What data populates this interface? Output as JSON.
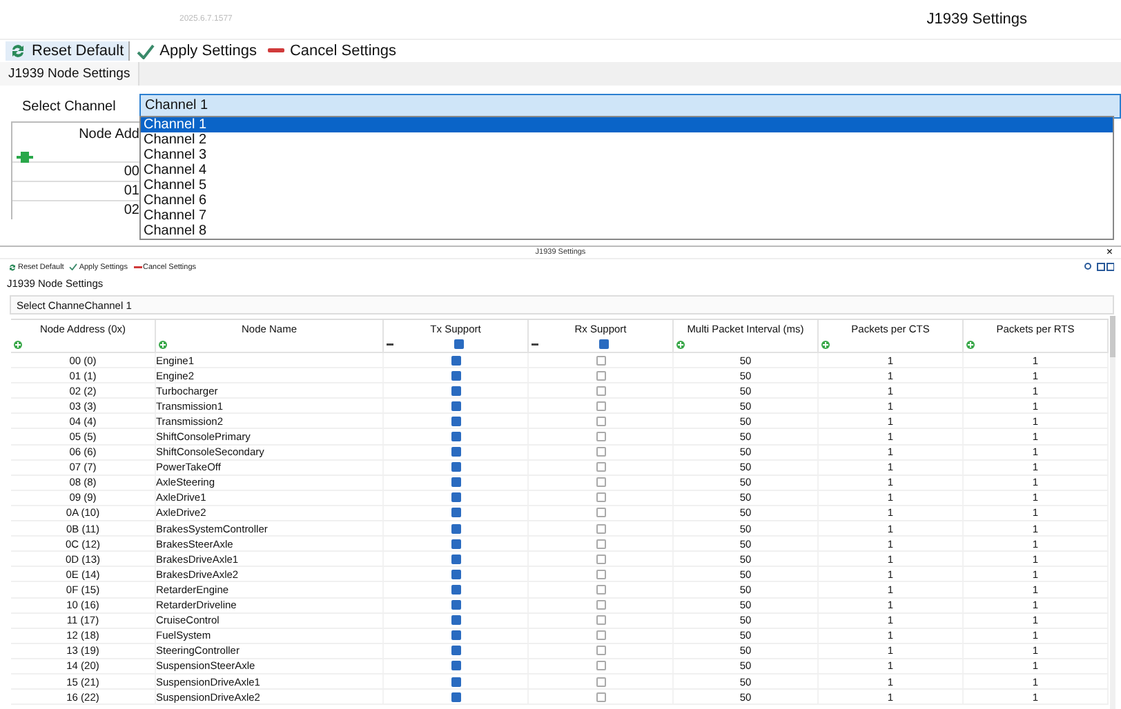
{
  "top_window": {
    "version": "2025.6.7.1577",
    "title": "J1939 Settings",
    "toolbar": [
      {
        "kind": "reset",
        "label": "Reset Default"
      },
      {
        "kind": "apply",
        "label": "Apply Settings"
      },
      {
        "kind": "cancel",
        "label": "Cancel Settings"
      }
    ],
    "tab": "J1939 Node Settings",
    "channel_label": "Select Channel",
    "channel_value": "Channel 1",
    "dropdown": [
      {
        "label": "Channel 1",
        "selected": true
      },
      {
        "label": "Channel 2",
        "selected": false
      },
      {
        "label": "Channel 3",
        "selected": false
      },
      {
        "label": "Channel 4",
        "selected": false
      },
      {
        "label": "Channel 5",
        "selected": false
      },
      {
        "label": "Channel 6",
        "selected": false
      },
      {
        "label": "Channel 7",
        "selected": false
      },
      {
        "label": "Channel 8",
        "selected": false
      }
    ],
    "table_header": "Node Add",
    "table_rows": [
      "00",
      "01",
      "02"
    ]
  },
  "bottom_window": {
    "title": "J1939 Settings",
    "close": "×",
    "toolbar": [
      {
        "kind": "reset",
        "label": "Reset Default"
      },
      {
        "kind": "apply",
        "label": "Apply Settings"
      },
      {
        "kind": "cancel",
        "label": "Cancel Settings"
      }
    ],
    "tab": "J1939 Node Settings",
    "channel_label": "Select Channe",
    "channel_value": "Channel 1",
    "columns": [
      {
        "label": "Node Address (0x)",
        "kind": "add"
      },
      {
        "label": "Node Name",
        "kind": "add"
      },
      {
        "label": "Tx Support",
        "kind": "check",
        "checked": true
      },
      {
        "label": "Rx Support",
        "kind": "check",
        "checked": true
      },
      {
        "label": "Multi Packet Interval (ms)",
        "kind": "add"
      },
      {
        "label": "Packets per CTS",
        "kind": "add"
      },
      {
        "label": "Packets per RTS",
        "kind": "add"
      }
    ],
    "rows": [
      {
        "address": "00 (0)",
        "name": "Engine1",
        "tx": true,
        "rx": false,
        "interval": "50",
        "cts": "1",
        "rts": "1"
      },
      {
        "address": "01 (1)",
        "name": "Engine2",
        "tx": true,
        "rx": false,
        "interval": "50",
        "cts": "1",
        "rts": "1"
      },
      {
        "address": "02 (2)",
        "name": "Turbocharger",
        "tx": true,
        "rx": false,
        "interval": "50",
        "cts": "1",
        "rts": "1"
      },
      {
        "address": "03 (3)",
        "name": "Transmission1",
        "tx": true,
        "rx": false,
        "interval": "50",
        "cts": "1",
        "rts": "1"
      },
      {
        "address": "04 (4)",
        "name": "Transmission2",
        "tx": true,
        "rx": false,
        "interval": "50",
        "cts": "1",
        "rts": "1"
      },
      {
        "address": "05 (5)",
        "name": "ShiftConsolePrimary",
        "tx": true,
        "rx": false,
        "interval": "50",
        "cts": "1",
        "rts": "1"
      },
      {
        "address": "06 (6)",
        "name": "ShiftConsoleSecondary",
        "tx": true,
        "rx": false,
        "interval": "50",
        "cts": "1",
        "rts": "1"
      },
      {
        "address": "07 (7)",
        "name": "PowerTakeOff",
        "tx": true,
        "rx": false,
        "interval": "50",
        "cts": "1",
        "rts": "1"
      },
      {
        "address": "08 (8)",
        "name": "AxleSteering",
        "tx": true,
        "rx": false,
        "interval": "50",
        "cts": "1",
        "rts": "1"
      },
      {
        "address": "09 (9)",
        "name": "AxleDrive1",
        "tx": true,
        "rx": false,
        "interval": "50",
        "cts": "1",
        "rts": "1"
      },
      {
        "address": "0A (10)",
        "name": "AxleDrive2",
        "tx": true,
        "rx": false,
        "interval": "50",
        "cts": "1",
        "rts": "1"
      },
      {
        "address": "0B (11)",
        "name": "BrakesSystemController",
        "tx": true,
        "rx": false,
        "interval": "50",
        "cts": "1",
        "rts": "1"
      },
      {
        "address": "0C (12)",
        "name": "BrakesSteerAxle",
        "tx": true,
        "rx": false,
        "interval": "50",
        "cts": "1",
        "rts": "1"
      },
      {
        "address": "0D (13)",
        "name": "BrakesDriveAxle1",
        "tx": true,
        "rx": false,
        "interval": "50",
        "cts": "1",
        "rts": "1"
      },
      {
        "address": "0E (14)",
        "name": "BrakesDriveAxle2",
        "tx": true,
        "rx": false,
        "interval": "50",
        "cts": "1",
        "rts": "1"
      },
      {
        "address": "0F (15)",
        "name": "RetarderEngine",
        "tx": true,
        "rx": false,
        "interval": "50",
        "cts": "1",
        "rts": "1"
      },
      {
        "address": "10 (16)",
        "name": "RetarderDriveline",
        "tx": true,
        "rx": false,
        "interval": "50",
        "cts": "1",
        "rts": "1"
      },
      {
        "address": "11 (17)",
        "name": "CruiseControl",
        "tx": true,
        "rx": false,
        "interval": "50",
        "cts": "1",
        "rts": "1"
      },
      {
        "address": "12 (18)",
        "name": "FuelSystem",
        "tx": true,
        "rx": false,
        "interval": "50",
        "cts": "1",
        "rts": "1"
      },
      {
        "address": "13 (19)",
        "name": "SteeringController",
        "tx": true,
        "rx": false,
        "interval": "50",
        "cts": "1",
        "rts": "1"
      },
      {
        "address": "14 (20)",
        "name": "SuspensionSteerAxle",
        "tx": true,
        "rx": false,
        "interval": "50",
        "cts": "1",
        "rts": "1"
      },
      {
        "address": "15 (21)",
        "name": "SuspensionDriveAxle1",
        "tx": true,
        "rx": false,
        "interval": "50",
        "cts": "1",
        "rts": "1"
      },
      {
        "address": "16 (22)",
        "name": "SuspensionDriveAxle2",
        "tx": true,
        "rx": false,
        "interval": "50",
        "cts": "1",
        "rts": "1"
      }
    ]
  }
}
